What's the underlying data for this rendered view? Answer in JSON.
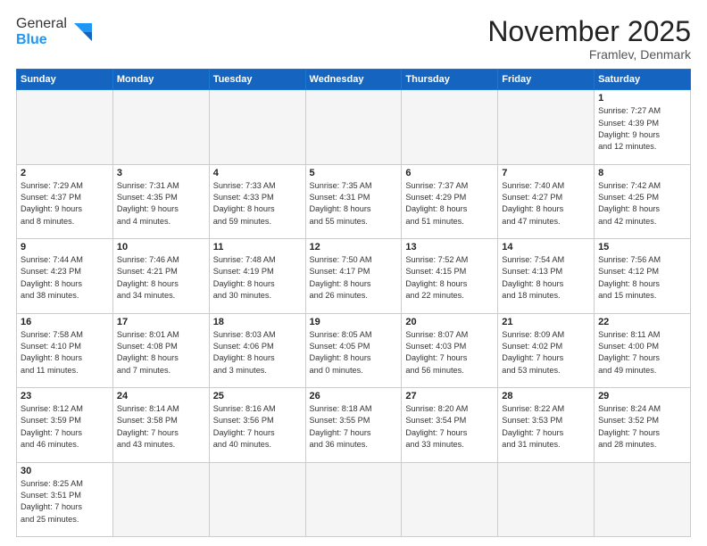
{
  "header": {
    "logo_general": "General",
    "logo_blue": "Blue",
    "month_title": "November 2025",
    "location": "Framlev, Denmark"
  },
  "weekdays": [
    "Sunday",
    "Monday",
    "Tuesday",
    "Wednesday",
    "Thursday",
    "Friday",
    "Saturday"
  ],
  "weeks": [
    [
      {
        "day": "",
        "info": ""
      },
      {
        "day": "",
        "info": ""
      },
      {
        "day": "",
        "info": ""
      },
      {
        "day": "",
        "info": ""
      },
      {
        "day": "",
        "info": ""
      },
      {
        "day": "",
        "info": ""
      },
      {
        "day": "1",
        "info": "Sunrise: 7:27 AM\nSunset: 4:39 PM\nDaylight: 9 hours\nand 12 minutes."
      }
    ],
    [
      {
        "day": "2",
        "info": "Sunrise: 7:29 AM\nSunset: 4:37 PM\nDaylight: 9 hours\nand 8 minutes."
      },
      {
        "day": "3",
        "info": "Sunrise: 7:31 AM\nSunset: 4:35 PM\nDaylight: 9 hours\nand 4 minutes."
      },
      {
        "day": "4",
        "info": "Sunrise: 7:33 AM\nSunset: 4:33 PM\nDaylight: 8 hours\nand 59 minutes."
      },
      {
        "day": "5",
        "info": "Sunrise: 7:35 AM\nSunset: 4:31 PM\nDaylight: 8 hours\nand 55 minutes."
      },
      {
        "day": "6",
        "info": "Sunrise: 7:37 AM\nSunset: 4:29 PM\nDaylight: 8 hours\nand 51 minutes."
      },
      {
        "day": "7",
        "info": "Sunrise: 7:40 AM\nSunset: 4:27 PM\nDaylight: 8 hours\nand 47 minutes."
      },
      {
        "day": "8",
        "info": "Sunrise: 7:42 AM\nSunset: 4:25 PM\nDaylight: 8 hours\nand 42 minutes."
      }
    ],
    [
      {
        "day": "9",
        "info": "Sunrise: 7:44 AM\nSunset: 4:23 PM\nDaylight: 8 hours\nand 38 minutes."
      },
      {
        "day": "10",
        "info": "Sunrise: 7:46 AM\nSunset: 4:21 PM\nDaylight: 8 hours\nand 34 minutes."
      },
      {
        "day": "11",
        "info": "Sunrise: 7:48 AM\nSunset: 4:19 PM\nDaylight: 8 hours\nand 30 minutes."
      },
      {
        "day": "12",
        "info": "Sunrise: 7:50 AM\nSunset: 4:17 PM\nDaylight: 8 hours\nand 26 minutes."
      },
      {
        "day": "13",
        "info": "Sunrise: 7:52 AM\nSunset: 4:15 PM\nDaylight: 8 hours\nand 22 minutes."
      },
      {
        "day": "14",
        "info": "Sunrise: 7:54 AM\nSunset: 4:13 PM\nDaylight: 8 hours\nand 18 minutes."
      },
      {
        "day": "15",
        "info": "Sunrise: 7:56 AM\nSunset: 4:12 PM\nDaylight: 8 hours\nand 15 minutes."
      }
    ],
    [
      {
        "day": "16",
        "info": "Sunrise: 7:58 AM\nSunset: 4:10 PM\nDaylight: 8 hours\nand 11 minutes."
      },
      {
        "day": "17",
        "info": "Sunrise: 8:01 AM\nSunset: 4:08 PM\nDaylight: 8 hours\nand 7 minutes."
      },
      {
        "day": "18",
        "info": "Sunrise: 8:03 AM\nSunset: 4:06 PM\nDaylight: 8 hours\nand 3 minutes."
      },
      {
        "day": "19",
        "info": "Sunrise: 8:05 AM\nSunset: 4:05 PM\nDaylight: 8 hours\nand 0 minutes."
      },
      {
        "day": "20",
        "info": "Sunrise: 8:07 AM\nSunset: 4:03 PM\nDaylight: 7 hours\nand 56 minutes."
      },
      {
        "day": "21",
        "info": "Sunrise: 8:09 AM\nSunset: 4:02 PM\nDaylight: 7 hours\nand 53 minutes."
      },
      {
        "day": "22",
        "info": "Sunrise: 8:11 AM\nSunset: 4:00 PM\nDaylight: 7 hours\nand 49 minutes."
      }
    ],
    [
      {
        "day": "23",
        "info": "Sunrise: 8:12 AM\nSunset: 3:59 PM\nDaylight: 7 hours\nand 46 minutes."
      },
      {
        "day": "24",
        "info": "Sunrise: 8:14 AM\nSunset: 3:58 PM\nDaylight: 7 hours\nand 43 minutes."
      },
      {
        "day": "25",
        "info": "Sunrise: 8:16 AM\nSunset: 3:56 PM\nDaylight: 7 hours\nand 40 minutes."
      },
      {
        "day": "26",
        "info": "Sunrise: 8:18 AM\nSunset: 3:55 PM\nDaylight: 7 hours\nand 36 minutes."
      },
      {
        "day": "27",
        "info": "Sunrise: 8:20 AM\nSunset: 3:54 PM\nDaylight: 7 hours\nand 33 minutes."
      },
      {
        "day": "28",
        "info": "Sunrise: 8:22 AM\nSunset: 3:53 PM\nDaylight: 7 hours\nand 31 minutes."
      },
      {
        "day": "29",
        "info": "Sunrise: 8:24 AM\nSunset: 3:52 PM\nDaylight: 7 hours\nand 28 minutes."
      }
    ],
    [
      {
        "day": "30",
        "info": "Sunrise: 8:25 AM\nSunset: 3:51 PM\nDaylight: 7 hours\nand 25 minutes."
      },
      {
        "day": "",
        "info": ""
      },
      {
        "day": "",
        "info": ""
      },
      {
        "day": "",
        "info": ""
      },
      {
        "day": "",
        "info": ""
      },
      {
        "day": "",
        "info": ""
      },
      {
        "day": "",
        "info": ""
      }
    ]
  ]
}
